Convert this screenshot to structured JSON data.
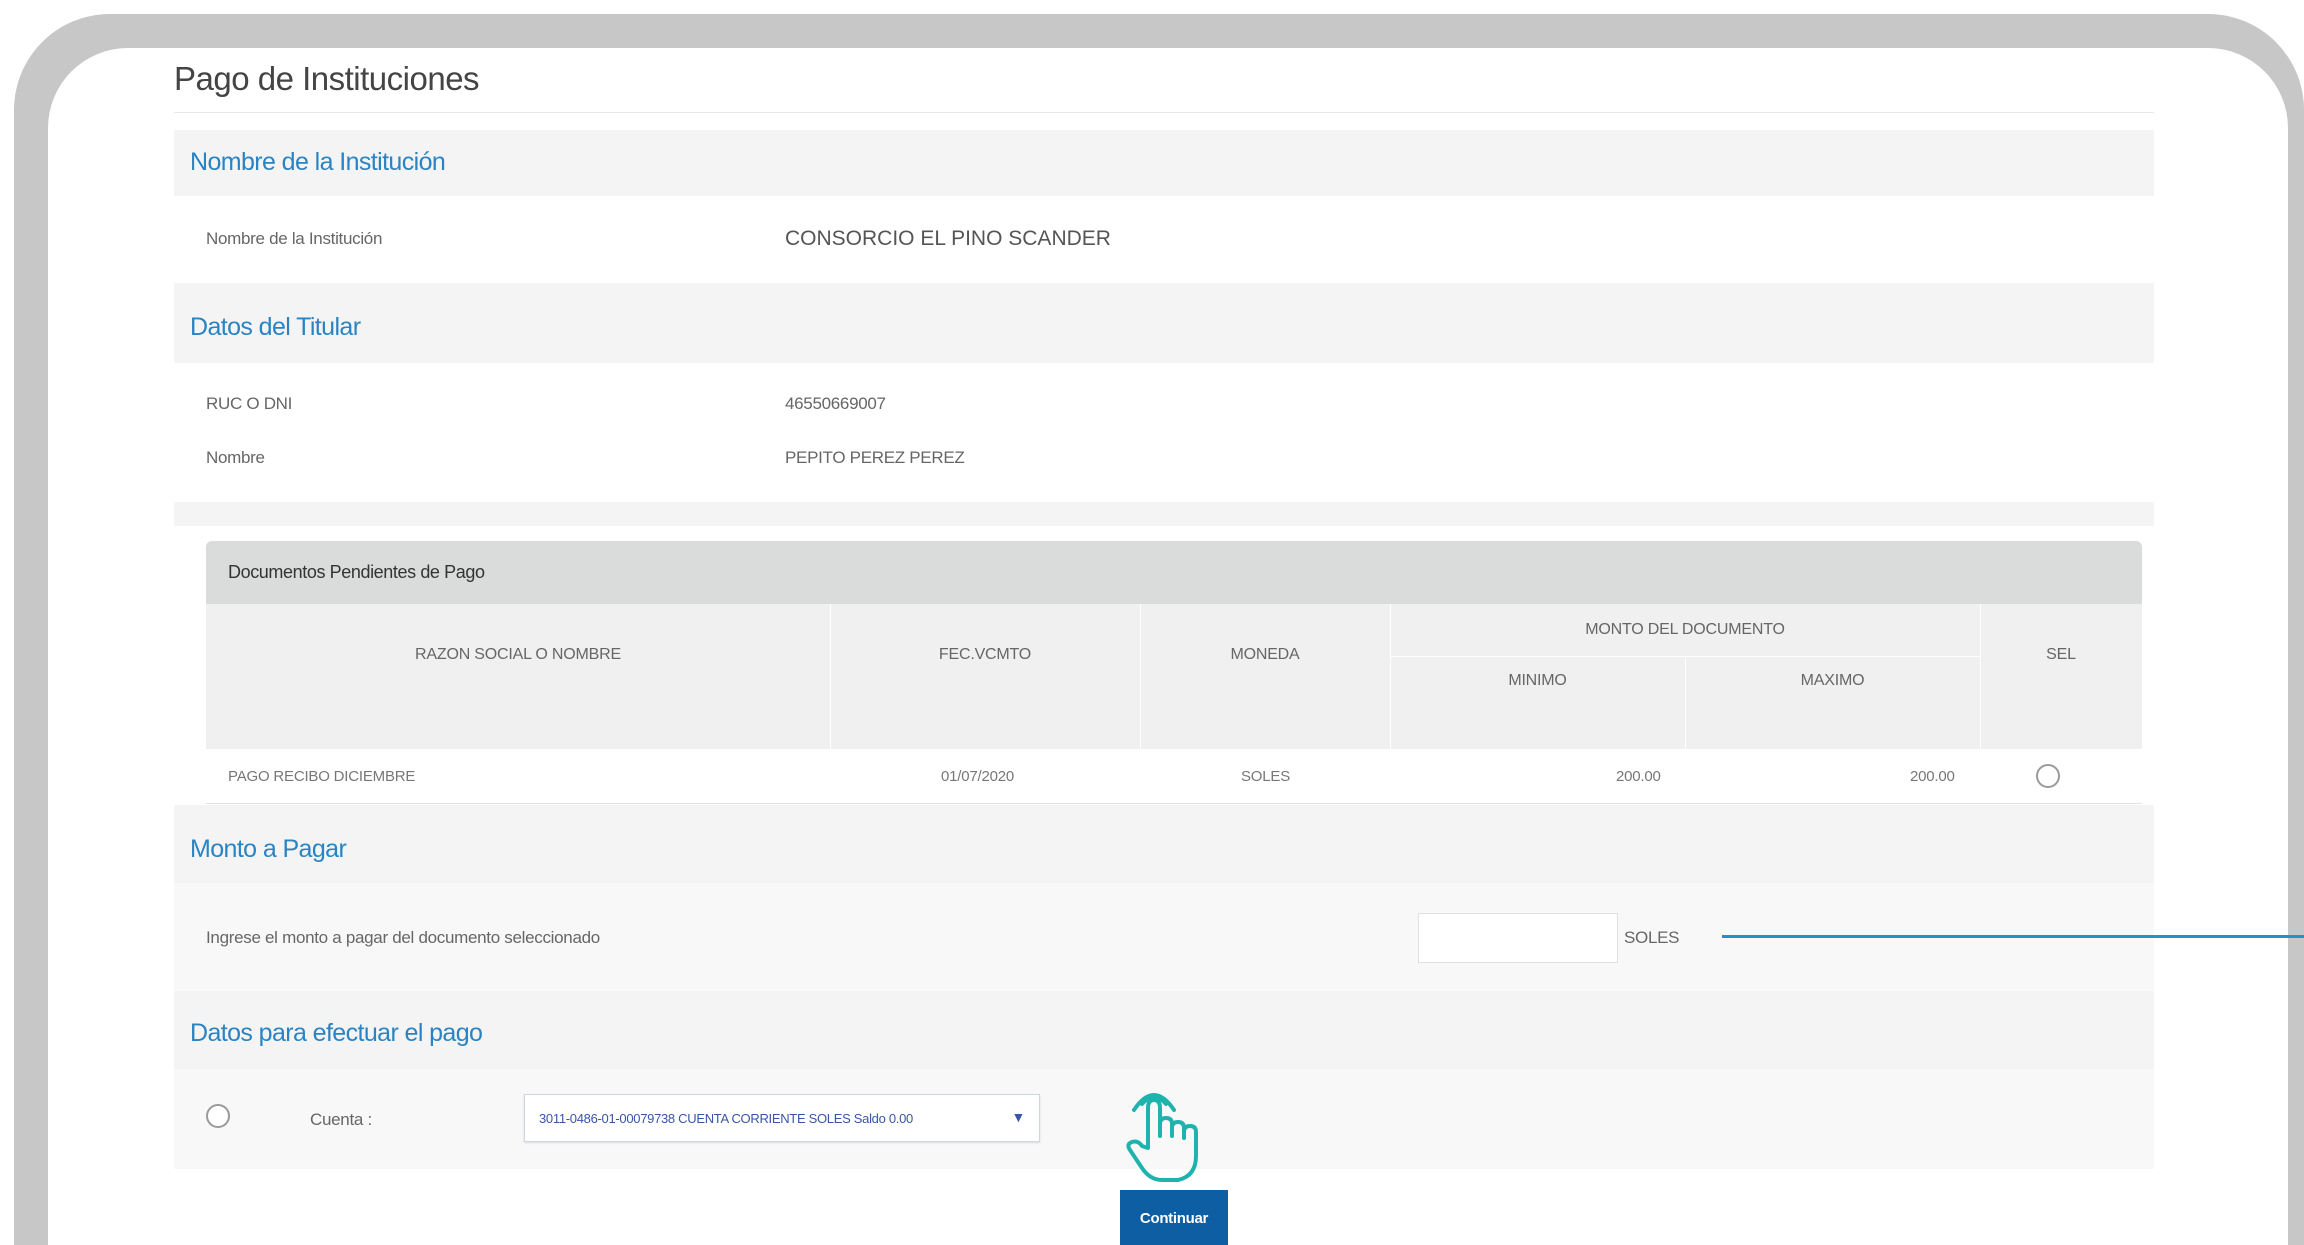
{
  "page": {
    "title": "Pago de Instituciones"
  },
  "institucion": {
    "section_title": "Nombre de la Institución",
    "label": "Nombre de la Institución",
    "value": "CONSORCIO EL PINO SCANDER"
  },
  "titular": {
    "section_title": "Datos del Titular",
    "ruc_label": "RUC O DNI",
    "ruc_value": "46550669007",
    "nombre_label": "Nombre",
    "nombre_value": "PEPITO PEREZ PEREZ"
  },
  "documentos": {
    "title": "Documentos Pendientes de Pago",
    "columns": {
      "razon": "RAZON SOCIAL O NOMBRE",
      "fecha": "FEC.VCMTO",
      "moneda": "MONEDA",
      "monto": "MONTO DEL DOCUMENTO",
      "minimo": "MINIMO",
      "maximo": "MAXIMO",
      "sel": "SEL"
    },
    "rows": [
      {
        "razon": "PAGO RECIBO DICIEMBRE",
        "fecha": "01/07/2020",
        "moneda": "SOLES",
        "minimo": "200.00",
        "maximo": "200.00"
      }
    ]
  },
  "monto": {
    "section_title": "Monto a Pagar",
    "label": "Ingrese el monto a pagar del documento seleccionado",
    "input_value": "",
    "currency": "SOLES"
  },
  "pago": {
    "section_title": "Datos para efectuar el pago",
    "cuenta_label": "Cuenta :",
    "cuenta_selected": "3011-0486-01-00079738 CUENTA CORRIENTE SOLES Saldo 0.00",
    "dropdown_icon": "triangle-down"
  },
  "actions": {
    "continue_label": "Continuar"
  },
  "colors": {
    "accent": "#2a83c2",
    "button": "#0e5ea3",
    "connector": "#1f93d1",
    "cursor": "#1fb3ad"
  }
}
